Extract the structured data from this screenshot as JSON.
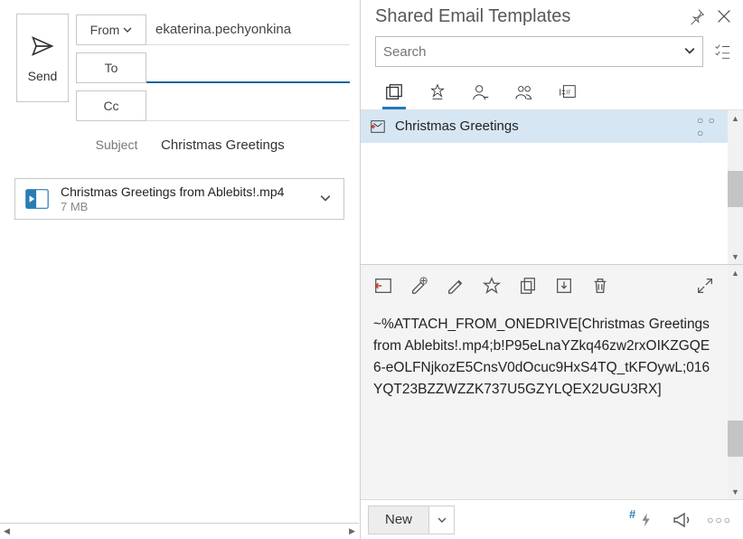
{
  "compose": {
    "send_label": "Send",
    "from_label": "From",
    "from_value": "ekaterina.pechyonkina",
    "to_label": "To",
    "to_value": "",
    "cc_label": "Cc",
    "cc_value": "",
    "subject_label": "Subject",
    "subject_value": "Christmas Greetings",
    "attachment": {
      "name": "Christmas Greetings from Ablebits!.mp4",
      "size": "7 MB"
    }
  },
  "panel": {
    "title": "Shared Email Templates",
    "search_placeholder": "Search",
    "template_list": [
      {
        "name": "Christmas Greetings"
      }
    ],
    "preview_text": "~%ATTACH_FROM_ONEDRIVE[Christmas Greetings from Ablebits!.mp4;b!P95eLnaYZkq46zw2rxOIKZGQE6-eOLFNjkozE5CnsV0dOcuc9HxS4TQ_tKFOywL;016YQT23BZZWZZK737U5GZYLQEX2UGU3RX]",
    "new_label": "New"
  }
}
